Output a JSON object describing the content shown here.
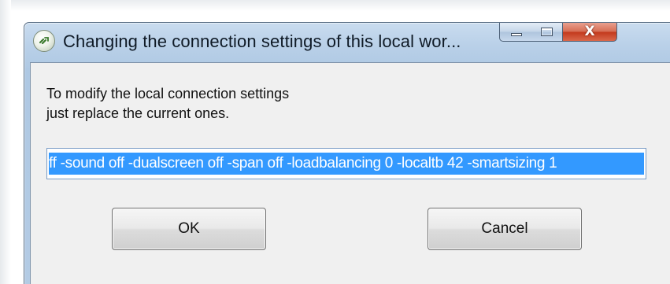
{
  "window": {
    "title": "Changing the connection settings of this local wor...",
    "app_icon": "remote-connection-icon",
    "caption_buttons": {
      "minimize_icon": "minimize-icon",
      "maximize_icon": "maximize-icon",
      "close_icon": "close-icon",
      "close_glyph": "X"
    }
  },
  "dialog": {
    "instruction_line1": "To modify the local connection settings",
    "instruction_line2": "just replace the current ones.",
    "settings_value": "ff -sound off -dualscreen off -span off -loadbalancing 0 -localtb 42 -smartsizing 1",
    "ok_label": "OK",
    "cancel_label": "Cancel"
  },
  "colors": {
    "selection": "#3399ff",
    "frame": "#b9d0e8",
    "close_button": "#c2391c"
  }
}
